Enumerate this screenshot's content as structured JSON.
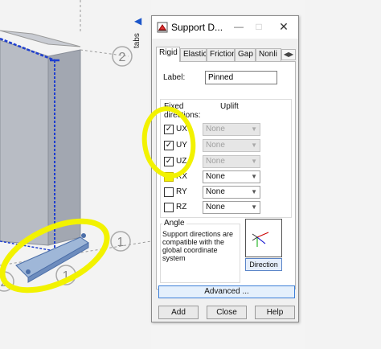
{
  "side_tab": {
    "label": "tabs"
  },
  "viewport": {
    "axis_labels": [
      "2",
      "1",
      "2",
      "1"
    ]
  },
  "dialog": {
    "title": "Support D...",
    "tabs": [
      "Rigid",
      "Elastic",
      "Friction",
      "Gap",
      "Nonli"
    ],
    "active_tab": "Rigid",
    "label_caption": "Label:",
    "label_value": "Pinned",
    "fixed_caption": "Fixed directions:",
    "uplift_caption": "Uplift",
    "directions": [
      {
        "name": "UX",
        "checked": true,
        "uplift": "None",
        "enabled": false
      },
      {
        "name": "UY",
        "checked": true,
        "uplift": "None",
        "enabled": false
      },
      {
        "name": "UZ",
        "checked": true,
        "uplift": "None",
        "enabled": false
      },
      {
        "name": "RX",
        "checked": false,
        "uplift": "None",
        "enabled": true
      },
      {
        "name": "RY",
        "checked": false,
        "uplift": "None",
        "enabled": true
      },
      {
        "name": "RZ",
        "checked": false,
        "uplift": "None",
        "enabled": true
      }
    ],
    "angle_caption": "Angle",
    "angle_description": "Support directions are compatible with the global coordinate system",
    "direction_button": "Direction",
    "advanced_button": "Advanced ...",
    "buttons": {
      "add": "Add",
      "close": "Close",
      "help": "Help"
    }
  },
  "colors": {
    "highlight": "#f2f200",
    "structure_blue": "#1f3fcf",
    "accent": "#3c7fd8"
  }
}
